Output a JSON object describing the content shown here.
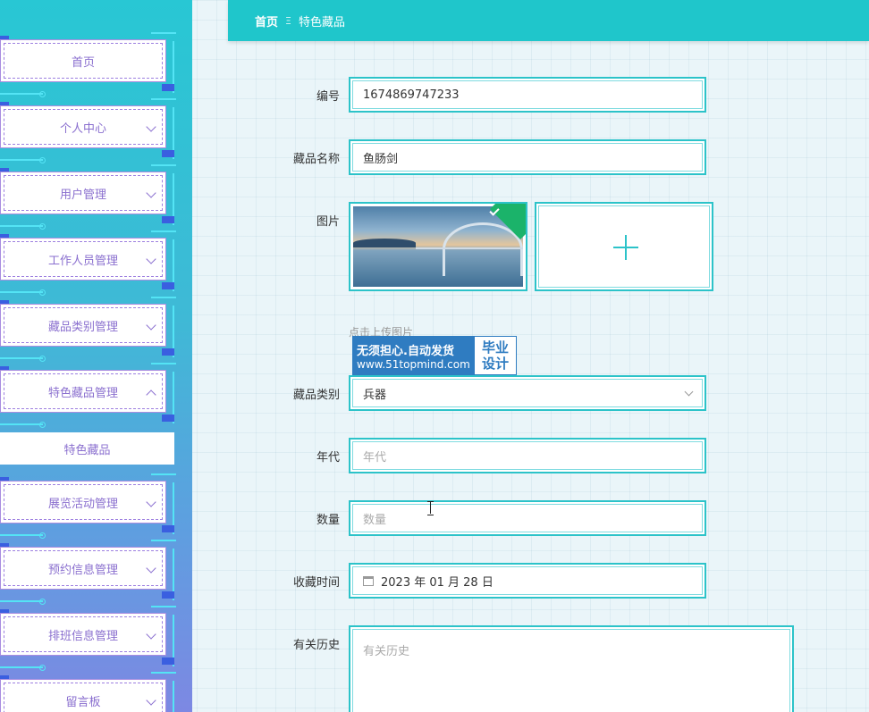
{
  "sidebar": {
    "items": [
      {
        "label": "首页",
        "has_chevron": false
      },
      {
        "label": "个人中心",
        "has_chevron": true
      },
      {
        "label": "用户管理",
        "has_chevron": true
      },
      {
        "label": "工作人员管理",
        "has_chevron": true
      },
      {
        "label": "藏品类别管理",
        "has_chevron": true
      },
      {
        "label": "特色藏品管理",
        "has_chevron": true,
        "expanded": true
      },
      {
        "label": "展览活动管理",
        "has_chevron": true
      },
      {
        "label": "预约信息管理",
        "has_chevron": true
      },
      {
        "label": "排班信息管理",
        "has_chevron": true
      },
      {
        "label": "留言板",
        "has_chevron": true
      }
    ],
    "submenu": {
      "label": "特色藏品"
    }
  },
  "breadcrumb": {
    "home": "首页",
    "separator": "Ξ",
    "current": "特色藏品"
  },
  "form": {
    "number": {
      "label": "编号",
      "value": "1674869747233"
    },
    "name": {
      "label": "藏品名称",
      "value": "鱼肠剑"
    },
    "image": {
      "label": "图片",
      "hint": "点击上传图片"
    },
    "category": {
      "label": "藏品类别",
      "value": "兵器"
    },
    "era": {
      "label": "年代",
      "placeholder": "年代"
    },
    "quantity": {
      "label": "数量",
      "placeholder": "数量"
    },
    "collect_time": {
      "label": "收藏时间",
      "value": "2023 年 01 月 28 日"
    },
    "history": {
      "label": "有关历史",
      "placeholder": "有关历史"
    }
  },
  "watermark": {
    "line1": "无须担心.自动发货",
    "line2": "www.51topmind.com",
    "right1": "毕业",
    "right2": "设计"
  },
  "colors": {
    "accent": "#1fc6cb",
    "menu_text": "#8a6fcf",
    "success_tag": "#1bb36a"
  }
}
